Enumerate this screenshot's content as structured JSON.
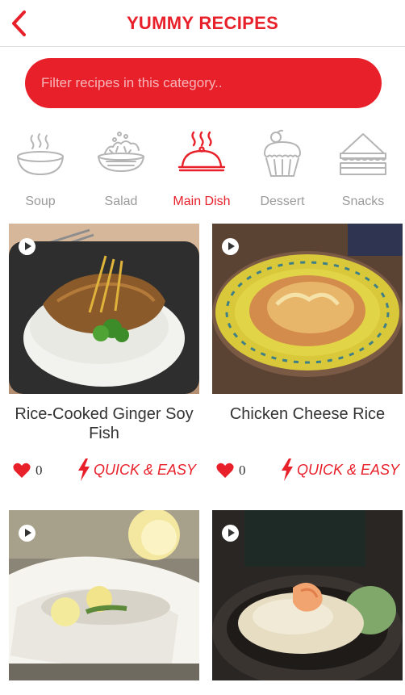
{
  "header": {
    "title": "YUMMY RECIPES"
  },
  "search": {
    "placeholder": "Filter recipes in this category.."
  },
  "categories": [
    {
      "label": "Soup",
      "icon": "soup-bowl-icon",
      "active": false
    },
    {
      "label": "Salad",
      "icon": "salad-bowl-icon",
      "active": false
    },
    {
      "label": "Main Dish",
      "icon": "cloche-icon",
      "active": true
    },
    {
      "label": "Dessert",
      "icon": "cupcake-icon",
      "active": false
    },
    {
      "label": "Snacks",
      "icon": "sandwich-icon",
      "active": false
    }
  ],
  "recipes": [
    {
      "name": "Rice-Cooked Ginger Soy Fish",
      "likes": "0",
      "tag": "QUICK & EASY"
    },
    {
      "name": "Chicken Cheese Rice",
      "likes": "0",
      "tag": "QUICK & EASY"
    },
    {
      "name": "",
      "likes": "",
      "tag": ""
    },
    {
      "name": "",
      "likes": "",
      "tag": ""
    }
  ],
  "colors": {
    "accent": "#e8202a",
    "inactive": "#9a9a9a"
  }
}
